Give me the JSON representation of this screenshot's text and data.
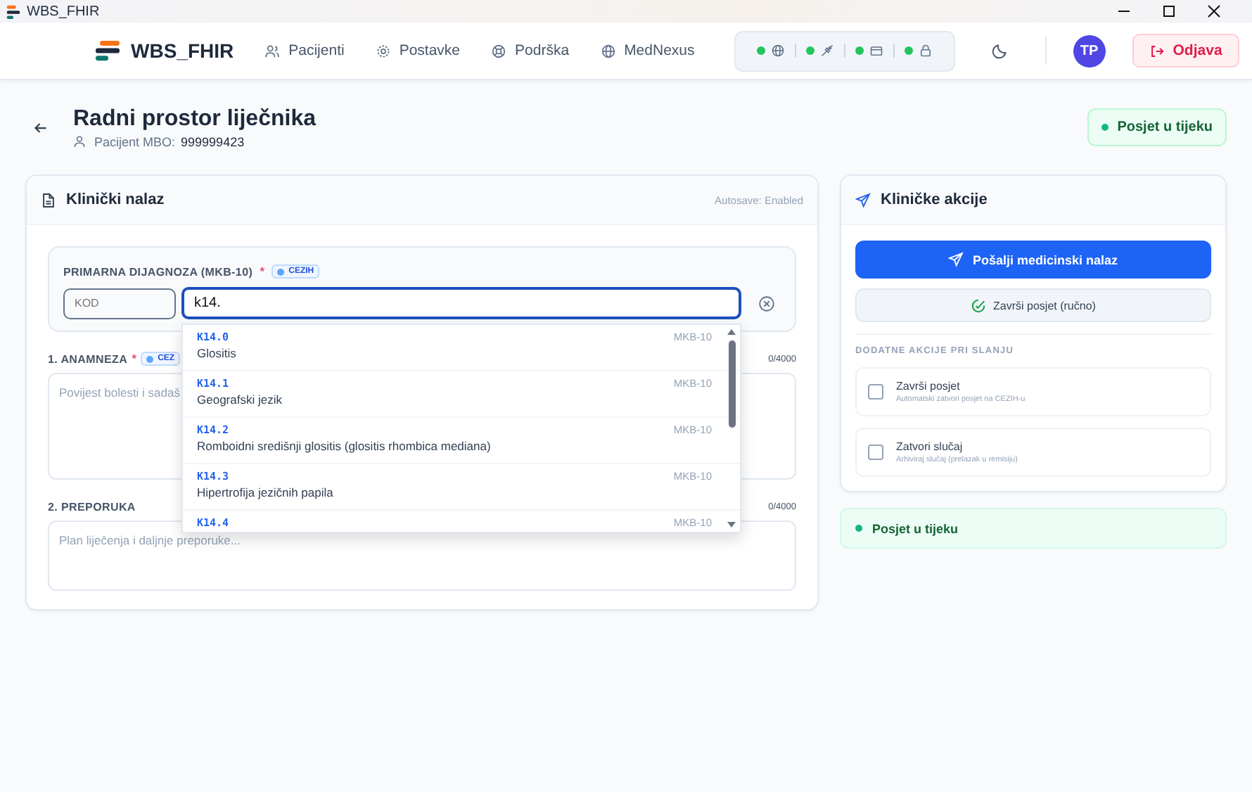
{
  "window": {
    "title": "WBS_FHIR"
  },
  "nav": {
    "brand": "WBS_FHIR",
    "links": [
      {
        "label": "Pacijenti"
      },
      {
        "label": "Postavke"
      },
      {
        "label": "Podrška"
      },
      {
        "label": "MedNexus"
      }
    ],
    "status_indicators": [
      {
        "online": true
      },
      {
        "online": true
      },
      {
        "online": true
      },
      {
        "online": true
      }
    ],
    "avatar": "TP",
    "logout": "Odjava"
  },
  "header": {
    "title": "Radni prostor liječnika",
    "patient_label": "Pacijent MBO:",
    "patient_mbo": "999999423",
    "status": "Posjet u tijeku"
  },
  "finding": {
    "title": "Klinički nalaz",
    "autosave": "Autosave: Enabled",
    "diagnosis": {
      "label": "PRIMARNA DIJAGNOZA (MKB-10)",
      "required_mark": "*",
      "badge": "CEZIH",
      "code_placeholder": "KOD",
      "search_value": "k14.",
      "suggestions": [
        {
          "code": "K14.0",
          "name": "Glositis",
          "system": "MKB-10"
        },
        {
          "code": "K14.1",
          "name": "Geografski jezik",
          "system": "MKB-10"
        },
        {
          "code": "K14.2",
          "name": "Romboidni središnji glositis (glositis rhombica mediana)",
          "system": "MKB-10"
        },
        {
          "code": "K14.3",
          "name": "Hipertrofija jezičnih papila",
          "system": "MKB-10"
        },
        {
          "code": "K14.4",
          "system": "MKB-10"
        }
      ]
    },
    "sections": [
      {
        "label": "1. ANAMNEZA",
        "required_mark": "*",
        "badge": "CEZ",
        "counter": "0/4000",
        "placeholder": "Povijest bolesti i sadaš"
      },
      {
        "label": "2. PREPORUKA",
        "counter": "0/4000",
        "placeholder": "Plan liječenja i daljnje preporuke..."
      }
    ]
  },
  "actions": {
    "title": "Kliničke akcije",
    "send_button": "Pošalji medicinski nalaz",
    "finish_button": "Završi posjet (ručno)",
    "extra_label": "DODATNE AKCIJE PRI SLANJU",
    "options": [
      {
        "title": "Završi posjet",
        "hint": "Automatski zatvori posjet na CEZIH-u",
        "checked": false
      },
      {
        "title": "Zatvori slučaj",
        "hint": "Arhiviraj slučaj (prelazak u remisiju)",
        "checked": false
      }
    ],
    "status": "Posjet u tijeku"
  }
}
